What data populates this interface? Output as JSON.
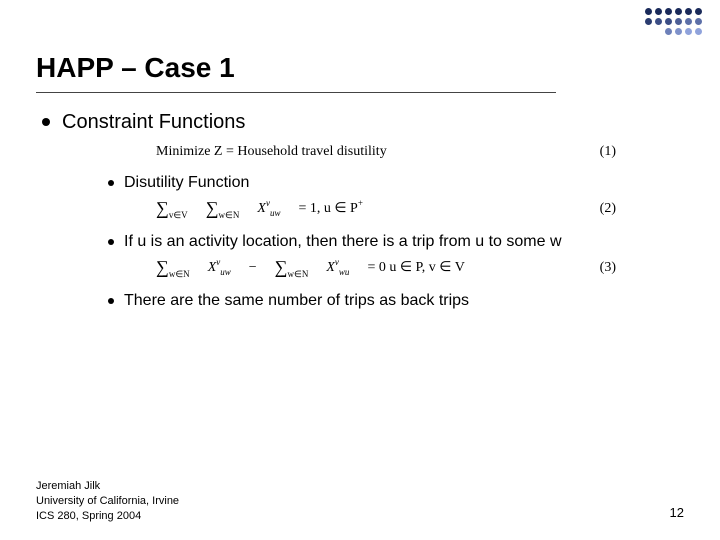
{
  "title": "HAPP – Case 1",
  "section": "Constraint Functions",
  "bullets": {
    "b1": "Disutility Function",
    "b2": "If u is an activity location, then there is a trip from u to some w",
    "b3": "There are the same number of trips as back trips"
  },
  "equations": {
    "eq1_text": "Minimize Z = Household travel disutility",
    "eq1_num": "(1)",
    "eq2_num": "(2)",
    "eq3_num": "(3)",
    "eq2_lhs_sub1": "v∈V",
    "eq2_lhs_sub2": "w∈N",
    "eq2_var": "X",
    "eq2_sup": "v",
    "eq2_sub": "uw",
    "eq2_rhs": "= 1, u ∈ P",
    "eq2_rhs_sup": "+",
    "eq3_sub1": "w∈N",
    "eq3_var": "X",
    "eq3_sup": "v",
    "eq3_suba": "uw",
    "eq3_minus": "−",
    "eq3_sub2": "w∈N",
    "eq3_subb": "wu",
    "eq3_rhs": "= 0 u ∈ P, v ∈ V"
  },
  "footer": {
    "l1": "Jeremiah Jilk",
    "l2": "University of California, Irvine",
    "l3": "ICS 280, Spring 2004"
  },
  "page": "12",
  "deco_colors": [
    "#1a2a5a",
    "#1a2a5a",
    "#1a2a5a",
    "#1a2a5a",
    "#1a2a5a",
    "#1a2a5a",
    "#2a3c70",
    "#3b4d85",
    "#3b4d85",
    "#4c5e96",
    "#5c6fa8",
    "#5c6fa8",
    "#ffffff",
    "#ffffff",
    "#6d80b9",
    "#7e91ca",
    "#8fa2db",
    "#8fa2db"
  ]
}
